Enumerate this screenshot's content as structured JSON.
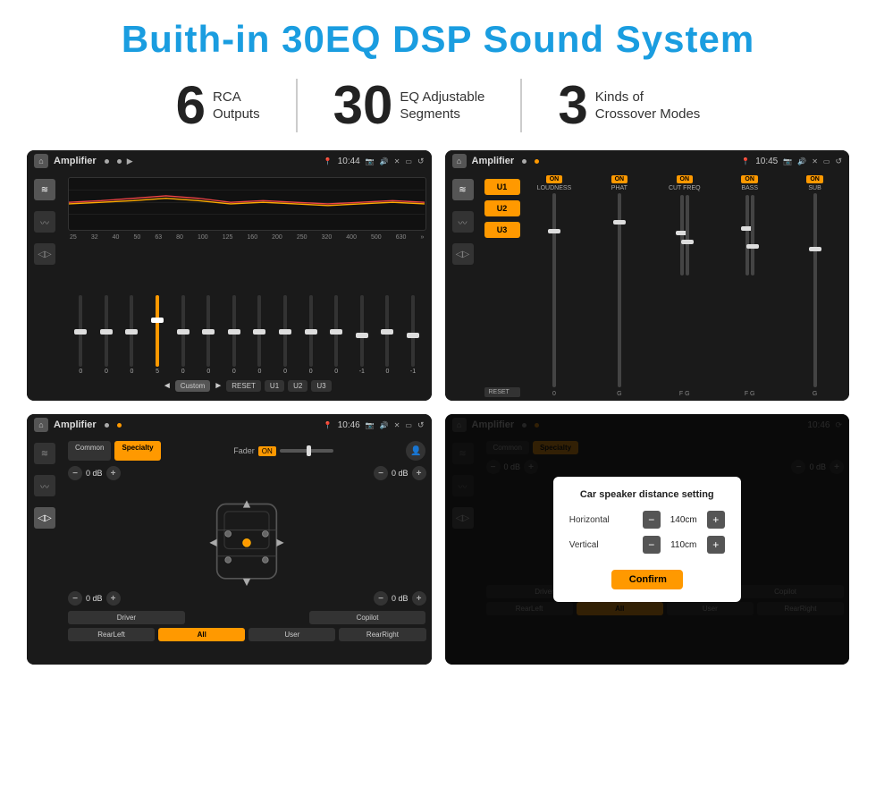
{
  "page": {
    "title": "Buith-in 30EQ DSP Sound System",
    "stats": [
      {
        "number": "6",
        "line1": "RCA",
        "line2": "Outputs"
      },
      {
        "number": "30",
        "line1": "EQ Adjustable",
        "line2": "Segments"
      },
      {
        "number": "3",
        "line1": "Kinds of",
        "line2": "Crossover Modes"
      }
    ]
  },
  "screens": {
    "eq": {
      "title": "Amplifier",
      "time": "10:44",
      "bands": [
        "25",
        "32",
        "40",
        "50",
        "63",
        "80",
        "100",
        "125",
        "160",
        "200",
        "250",
        "320",
        "400",
        "500",
        "630"
      ],
      "values": [
        "0",
        "0",
        "0",
        "5",
        "0",
        "0",
        "0",
        "0",
        "0",
        "0",
        "0",
        "-1",
        "0",
        "-1"
      ],
      "buttons": [
        "Custom",
        "RESET",
        "U1",
        "U2",
        "U3"
      ]
    },
    "crossover": {
      "title": "Amplifier",
      "time": "10:45",
      "channels": [
        "LOUDNESS",
        "PHAT",
        "CUT FREQ",
        "BASS",
        "SUB"
      ],
      "u_buttons": [
        "U1",
        "U2",
        "U3"
      ],
      "reset_label": "RESET"
    },
    "fader": {
      "title": "Amplifier",
      "time": "10:46",
      "tabs": [
        "Common",
        "Specialty"
      ],
      "fader_label": "Fader",
      "on_label": "ON",
      "controls": [
        "0 dB",
        "0 dB",
        "0 dB",
        "0 dB"
      ],
      "positions": [
        "Driver",
        "Copilot",
        "RearLeft",
        "All",
        "User",
        "RearRight"
      ]
    },
    "dialog": {
      "title": "Amplifier",
      "time": "10:46",
      "dialog_title": "Car speaker distance setting",
      "horizontal_label": "Horizontal",
      "horizontal_value": "140cm",
      "vertical_label": "Vertical",
      "vertical_value": "110cm",
      "confirm_label": "Confirm"
    }
  }
}
